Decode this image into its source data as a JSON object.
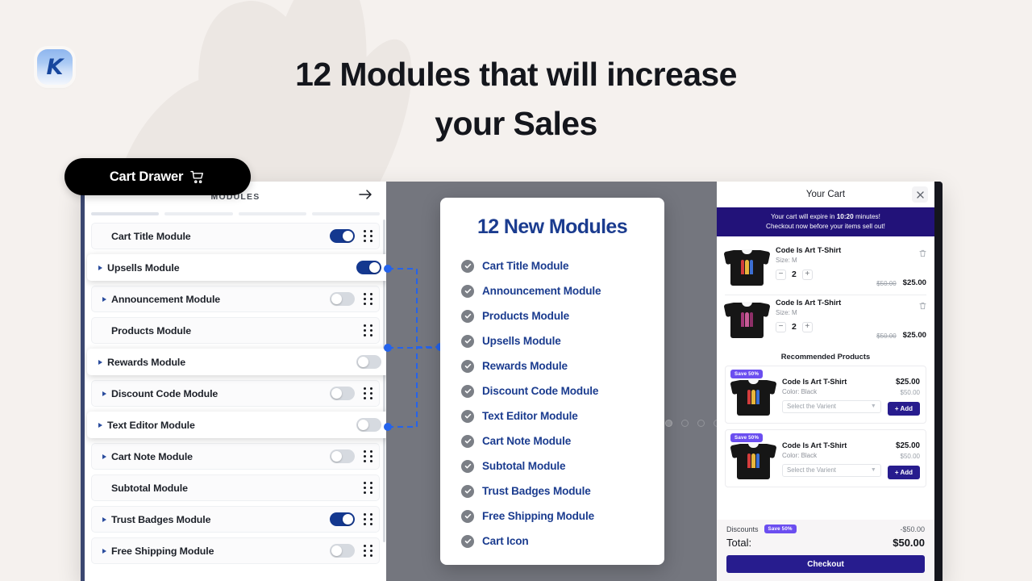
{
  "brand": {
    "logo_letter": "K"
  },
  "headline": {
    "line1": "12 Modules that will increase",
    "line2": "your Sales"
  },
  "badge": {
    "label": "Cart Drawer",
    "icon": "shopping-cart-icon"
  },
  "modules_panel": {
    "header_title": "MODULES",
    "forward_arrow": "→",
    "rows": [
      {
        "label": "Cart Title Module",
        "caret": false,
        "toggle": "on",
        "highlighted": false
      },
      {
        "label": "Upsells Module",
        "caret": true,
        "toggle": "on",
        "highlighted": true
      },
      {
        "label": "Announcement Module",
        "caret": true,
        "toggle": "off",
        "highlighted": false
      },
      {
        "label": "Products Module",
        "caret": false,
        "toggle": "none",
        "highlighted": false
      },
      {
        "label": "Rewards Module",
        "caret": true,
        "toggle": "off",
        "highlighted": true
      },
      {
        "label": "Discount Code Module",
        "caret": true,
        "toggle": "off",
        "highlighted": false
      },
      {
        "label": "Text Editor Module",
        "caret": true,
        "toggle": "off",
        "highlighted": true
      },
      {
        "label": "Cart Note Module",
        "caret": true,
        "toggle": "off",
        "highlighted": false
      },
      {
        "label": "Subtotal Module",
        "caret": false,
        "toggle": "none",
        "highlighted": false
      },
      {
        "label": "Trust Badges Module",
        "caret": true,
        "toggle": "on",
        "highlighted": false
      },
      {
        "label": "Free Shipping Module",
        "caret": true,
        "toggle": "off",
        "highlighted": false
      }
    ]
  },
  "promo_card": {
    "title": "12 New Modules",
    "items": [
      "Cart Title Module",
      "Announcement Module",
      "Products Module",
      "Upsells Module",
      "Rewards Module",
      "Discount Code Module",
      "Text Editor Module",
      "Cart Note Module",
      "Subtotal Module",
      "Trust Badges Module",
      "Free Shipping Module",
      "Cart Icon"
    ]
  },
  "cart": {
    "title": "Your Cart",
    "close_icon": "close-icon",
    "banner": {
      "prefix": "Your cart will expire in ",
      "time": "10:20",
      "suffix": " minutes!",
      "line2": "Checkout now before your items sell out!"
    },
    "items": [
      {
        "name": "Code Is Art T-Shirt",
        "variant": "Size: M",
        "qty": "2",
        "old_price": "$50.00",
        "price": "$25.00",
        "minus": "−",
        "plus": "+"
      },
      {
        "name": "Code Is Art T-Shirt",
        "variant": "Size: M",
        "qty": "2",
        "old_price": "$50.00",
        "price": "$25.00",
        "minus": "−",
        "plus": "+"
      }
    ],
    "recommended_title": "Recommended Products",
    "recommended": [
      {
        "badge": "Save 50%",
        "name": "Code Is Art T-Shirt",
        "variant": "Color: Black",
        "select_placeholder": "Select the Varient",
        "price": "$25.00",
        "old_price": "$50.00",
        "add_label": "+ Add"
      },
      {
        "badge": "Save 50%",
        "name": "Code Is Art T-Shirt",
        "variant": "Color: Black",
        "select_placeholder": "Select the Varient",
        "price": "$25.00",
        "old_price": "$50.00",
        "add_label": "+ Add"
      }
    ],
    "footer": {
      "discount_label": "Discounts",
      "discount_badge": "Save 50%",
      "discount_amount": "-$50.00",
      "total_label": "Total:",
      "total_amount": "$50.00",
      "checkout_label": "Checkout"
    }
  },
  "colors": {
    "page_bg": "#f5f1ee",
    "brand_blue": "#1b3c8f",
    "toggle_on": "#14388f",
    "cart_accent": "#271c8e",
    "banner": "#221279",
    "save_badge": "#6b4ef0",
    "connector": "#2563eb"
  }
}
